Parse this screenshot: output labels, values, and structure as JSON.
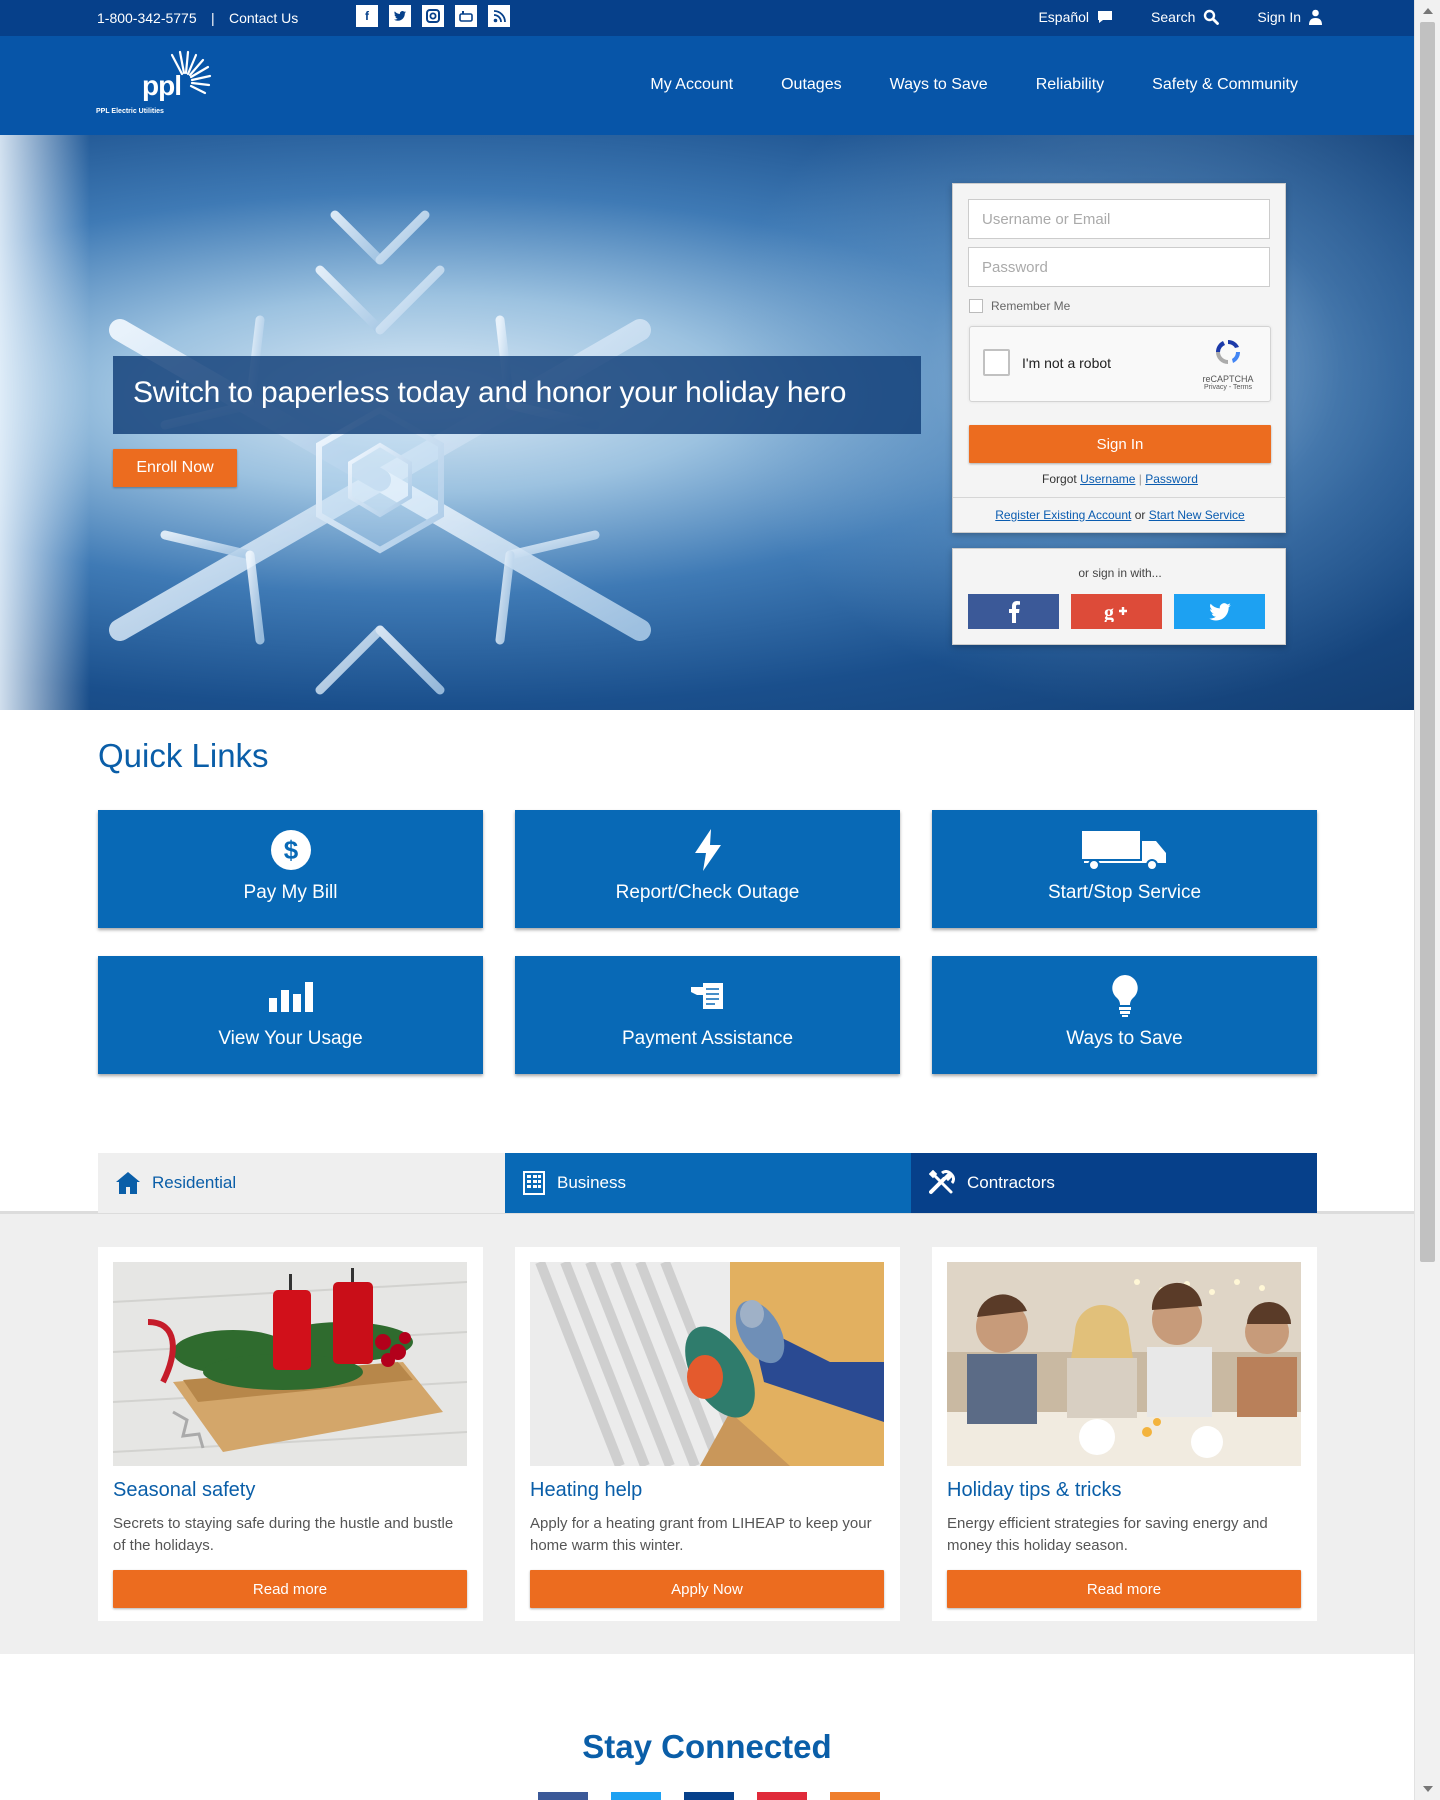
{
  "utility": {
    "phone": "1-800-342-5775",
    "separator": "|",
    "contact": "Contact Us",
    "social": [
      "f",
      "t",
      "ig",
      "yt",
      "rss"
    ],
    "espanol": "Español",
    "search": "Search",
    "signin": "Sign In"
  },
  "brand": {
    "name": "ppl",
    "subtitle": "PPL Electric Utilities"
  },
  "nav": {
    "items": [
      "My Account",
      "Outages",
      "Ways to Save",
      "Reliability",
      "Safety & Community"
    ]
  },
  "hero": {
    "headline": "Switch to paperless today and honor your holiday hero",
    "cta": "Enroll Now"
  },
  "login": {
    "username_placeholder": "Username or Email",
    "password_placeholder": "Password",
    "remember": "Remember Me",
    "captcha_label": "I'm not a robot",
    "captcha_brand": "reCAPTCHA",
    "captcha_links": "Privacy - Terms",
    "signin_button": "Sign In",
    "forgot_prefix": "Forgot",
    "forgot_username": "Username",
    "forgot_sep": "|",
    "forgot_password": "Password",
    "register_link": "Register Existing Account",
    "register_or": "or",
    "new_service_link": "Start New Service",
    "social_prompt": "or sign in with..."
  },
  "quick_links": {
    "title": "Quick Links",
    "items": [
      {
        "label": "Pay My Bill",
        "icon": "dollar-icon"
      },
      {
        "label": "Report/Check Outage",
        "icon": "lightning-icon"
      },
      {
        "label": "Start/Stop Service",
        "icon": "truck-icon"
      },
      {
        "label": "View Your Usage",
        "icon": "bar-chart-icon"
      },
      {
        "label": "Payment Assistance",
        "icon": "hand-bill-icon"
      },
      {
        "label": "Ways to Save",
        "icon": "lightbulb-icon"
      }
    ]
  },
  "tabs": [
    {
      "label": "Residential",
      "icon": "house-icon"
    },
    {
      "label": "Business",
      "icon": "building-icon"
    },
    {
      "label": "Contractors",
      "icon": "tools-icon"
    }
  ],
  "cards": [
    {
      "title": "Seasonal safety",
      "text": "Secrets to staying safe during the hustle and bustle of the holidays.",
      "button": "Read more"
    },
    {
      "title": "Heating help",
      "text": "Apply for a heating grant from LIHEAP to keep your home warm this winter.",
      "button": "Apply Now"
    },
    {
      "title": "Holiday tips & tricks",
      "text": "Energy efficient strategies for saving energy and money this holiday season.",
      "button": "Read more"
    }
  ],
  "stay_connected": {
    "title": "Stay Connected"
  },
  "colors": {
    "navy": "#06408a",
    "nav_blue": "#0755a8",
    "tile_blue": "#0869b6",
    "accent_orange": "#ec6c1f"
  }
}
